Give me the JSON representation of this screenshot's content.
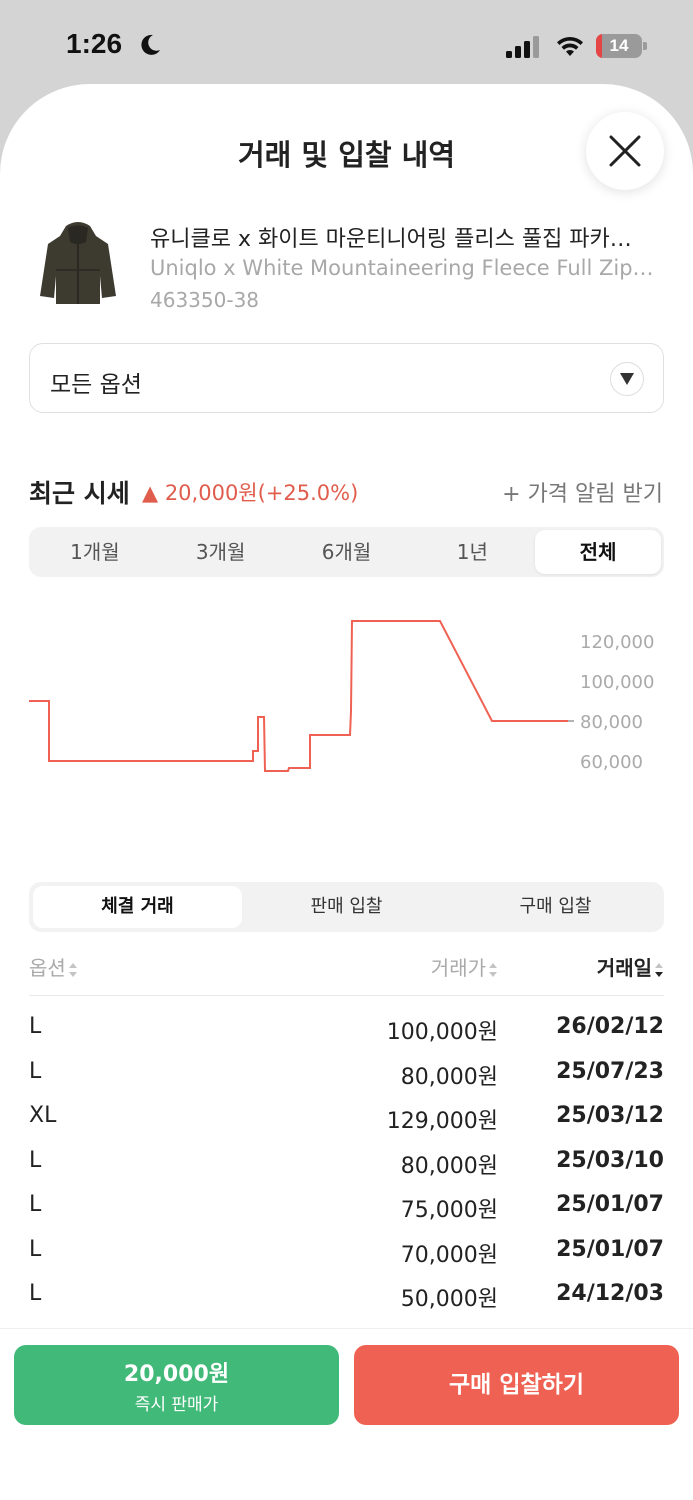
{
  "status_bar": {
    "time": "1:26",
    "battery_level": "14",
    "battery_fraction": 0.14
  },
  "header": {
    "title": "거래 및 입찰 내역"
  },
  "product": {
    "name_ko": "유니클로 x 화이트 마운티니어링 플리스 풀집 파카…",
    "name_en": "Uniqlo x White Mountaineering Fleece Full Zip…",
    "code": "463350-38",
    "image_icon": "jacket-thumbnail"
  },
  "option_select": {
    "value": "모든 옵션"
  },
  "recent_price": {
    "title": "최근 시세",
    "change": "▲ 20,000원(+25.0%)",
    "alert_label": "+ 가격 알림 받기"
  },
  "period_tabs": [
    {
      "label": "1개월",
      "active": false
    },
    {
      "label": "3개월",
      "active": false
    },
    {
      "label": "6개월",
      "active": false
    },
    {
      "label": "1년",
      "active": false
    },
    {
      "label": "전체",
      "active": true
    }
  ],
  "chart_data": {
    "type": "line",
    "series": [
      {
        "values": [
          90000,
          90000,
          60000,
          60000,
          60000,
          60000,
          65000,
          82000,
          55000,
          55000,
          73000,
          73000,
          85000,
          130000,
          130000,
          80000,
          80000
        ]
      }
    ],
    "y_ticks": [
      "120,000",
      "100,000",
      "80,000",
      "60,000"
    ],
    "ylim": [
      50000,
      135000
    ],
    "line_color": "#ef6253",
    "grid": false
  },
  "trade_tabs": [
    {
      "label": "체결 거래",
      "active": true
    },
    {
      "label": "판매 입찰",
      "active": false
    },
    {
      "label": "구매 입찰",
      "active": false
    }
  ],
  "table": {
    "headers": {
      "option": "옵션",
      "price": "거래가",
      "date": "거래일"
    },
    "rows": [
      {
        "option": "L",
        "price": "100,000원",
        "date": "26/02/12"
      },
      {
        "option": "L",
        "price": "80,000원",
        "date": "25/07/23"
      },
      {
        "option": "XL",
        "price": "129,000원",
        "date": "25/03/12"
      },
      {
        "option": "L",
        "price": "80,000원",
        "date": "25/03/10"
      },
      {
        "option": "L",
        "price": "75,000원",
        "date": "25/01/07"
      },
      {
        "option": "L",
        "price": "70,000원",
        "date": "25/01/07"
      },
      {
        "option": "L",
        "price": "50,000원",
        "date": "24/12/03"
      }
    ]
  },
  "actions": {
    "sell_price": "20,000원",
    "sell_label": "즉시 판매가",
    "buy_label": "구매 입찰하기",
    "sell_color": "#41b979",
    "buy_color": "#ef6253"
  }
}
